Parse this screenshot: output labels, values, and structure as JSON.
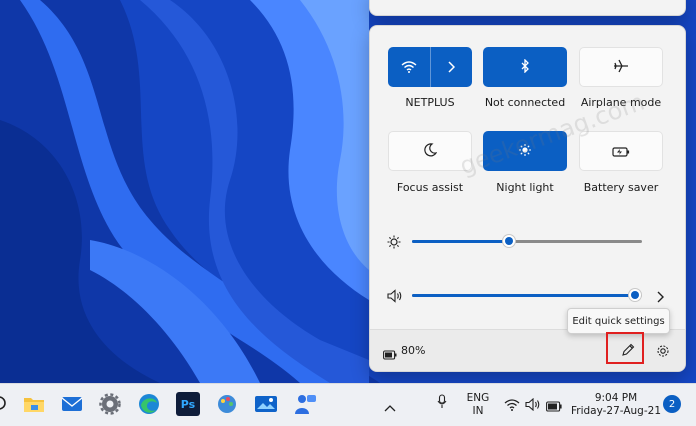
{
  "quick_settings": {
    "tiles": [
      {
        "label": "NETPLUS",
        "icon": "wifi-icon",
        "state": "on"
      },
      {
        "label": "Not connected",
        "icon": "bluetooth-icon",
        "state": "on"
      },
      {
        "label": "Airplane mode",
        "icon": "airplane-icon",
        "state": "off"
      },
      {
        "label": "Focus assist",
        "icon": "moon-icon",
        "state": "off"
      },
      {
        "label": "Night light",
        "icon": "sun-icon",
        "state": "on"
      },
      {
        "label": "Battery saver",
        "icon": "battery-saver-icon",
        "state": "off"
      }
    ],
    "brightness": {
      "level": 0.42,
      "icon": "brightness-icon"
    },
    "volume": {
      "level": 0.97,
      "icon": "speaker-icon"
    },
    "battery_text": "80%",
    "tooltip": "Edit quick settings"
  },
  "taskbar": {
    "apps": [
      "search-icon",
      "file-explorer-icon",
      "mail-icon",
      "settings-icon",
      "edge-icon",
      "photoshop-icon",
      "paint-icon",
      "photos-icon",
      "teams-icon"
    ],
    "photoshop_label": "Ps",
    "lang_line1": "ENG",
    "lang_line2": "IN",
    "time": "9:04 PM",
    "date": "Friday-27-Aug-21",
    "notification_count": "2"
  },
  "watermark": "geekermag.com",
  "colors": {
    "accent": "#0b5fc3",
    "highlight": "#e02020"
  }
}
